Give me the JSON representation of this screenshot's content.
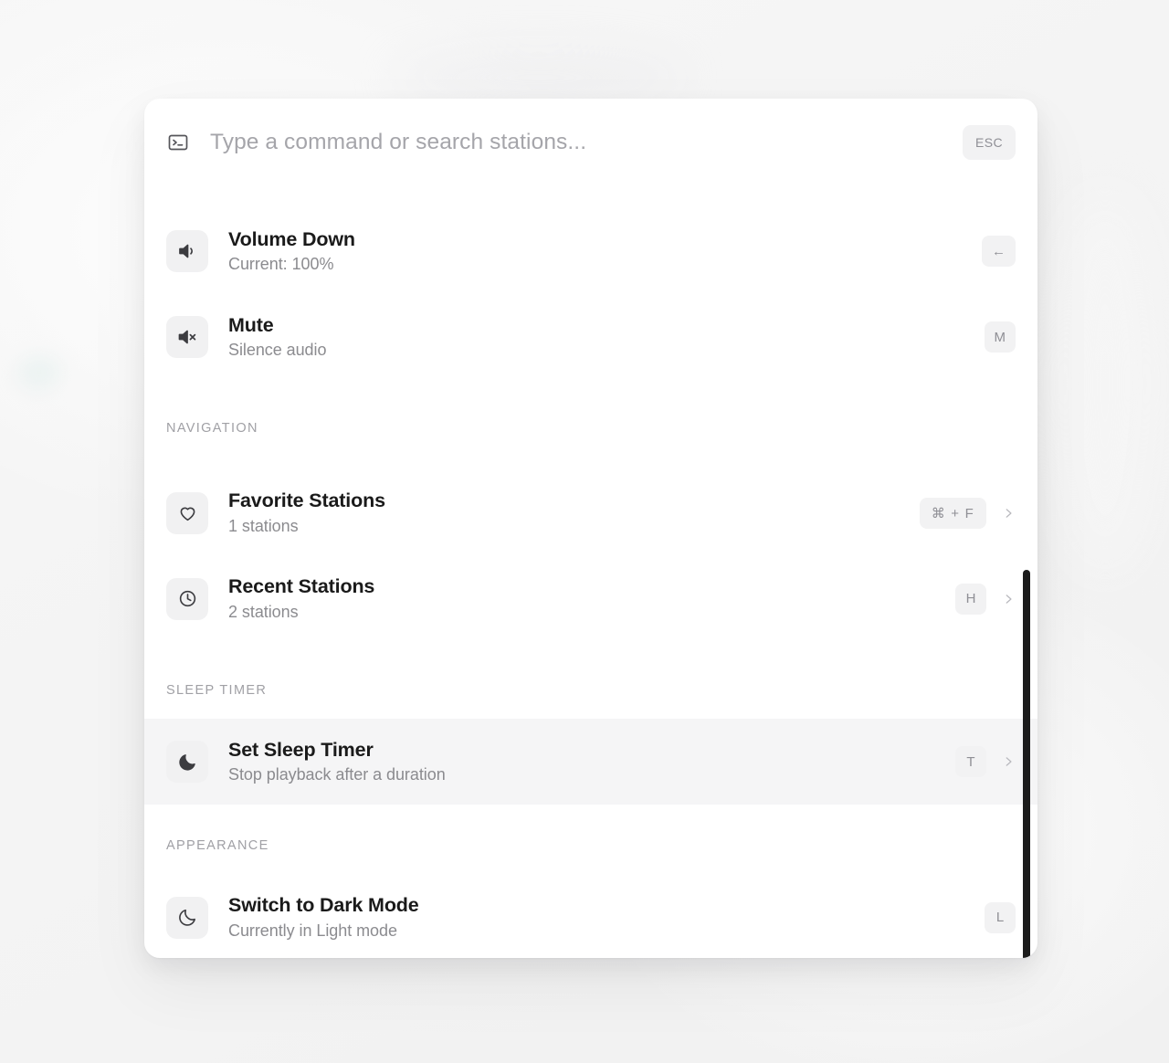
{
  "backdrop": {
    "note": "soft light-gray gradient"
  },
  "palette": {
    "search": {
      "icon": "terminal-prompt-icon",
      "value": "",
      "placeholder": "Type a command or search stations...",
      "escape_key": "ESC"
    },
    "groups": [
      {
        "id": "ungrouped-top",
        "label": "",
        "items": [
          {
            "icon": "volume-down-icon",
            "title": "Volume Down",
            "subtitle": "Current: 100%",
            "shortcut": "←",
            "shortcut_wide": false,
            "has_chevron": false,
            "active": false
          },
          {
            "icon": "volume-mute-icon",
            "title": "Mute",
            "subtitle": "Silence audio",
            "shortcut": "M",
            "shortcut_wide": false,
            "has_chevron": false,
            "active": false
          }
        ]
      },
      {
        "id": "navigation",
        "label": "NAVIGATION",
        "items": [
          {
            "icon": "heart-icon",
            "title": "Favorite Stations",
            "subtitle": "1 stations",
            "shortcut": "⌘ + F",
            "shortcut_wide": true,
            "has_chevron": true,
            "active": false
          },
          {
            "icon": "clock-icon",
            "title": "Recent Stations",
            "subtitle": "2 stations",
            "shortcut": "H",
            "shortcut_wide": false,
            "has_chevron": true,
            "active": false
          }
        ]
      },
      {
        "id": "sleep-timer",
        "label": "SLEEP TIMER",
        "items": [
          {
            "icon": "moon-filled-icon",
            "title": "Set Sleep Timer",
            "subtitle": "Stop playback after a duration",
            "shortcut": "T",
            "shortcut_wide": false,
            "has_chevron": true,
            "active": true
          }
        ]
      },
      {
        "id": "appearance",
        "label": "APPEARANCE",
        "items": [
          {
            "icon": "moon-outline-icon",
            "title": "Switch to Dark Mode",
            "subtitle": "Currently in Light mode",
            "shortcut": "L",
            "shortcut_wide": false,
            "has_chevron": false,
            "active": false
          }
        ]
      }
    ],
    "scrollbar": {
      "name": "vertical-scrollbar"
    }
  },
  "colors": {
    "panel_background": "#ffffff",
    "title_text": "#1a1a1a",
    "subtitle_text": "#8b8b8f",
    "section_label": "#a0a0a5",
    "tile_background": "#f1f1f2",
    "key_background": "#f2f2f3",
    "active_row": "#f5f5f6",
    "scrollbar_thumb": "#1c1c1c"
  }
}
